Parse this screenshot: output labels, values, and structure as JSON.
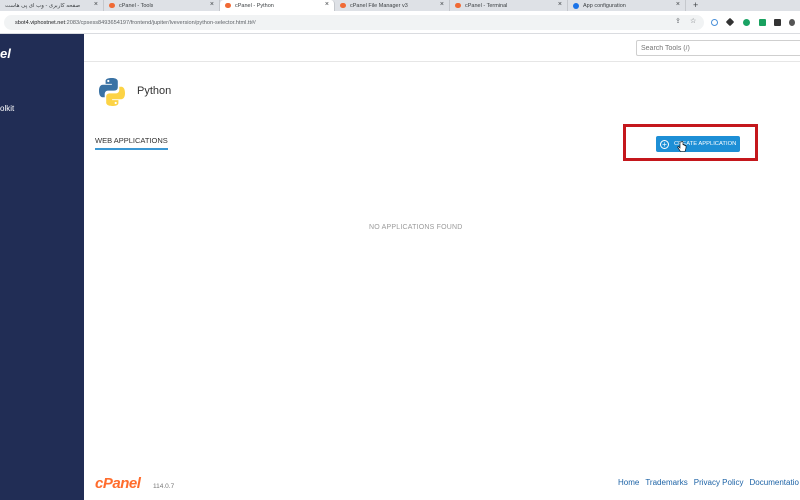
{
  "browser": {
    "tabs": [
      {
        "title": "صفحه کاربری - وب آی پی هاست",
        "active": false
      },
      {
        "title": "cPanel - Tools",
        "active": false
      },
      {
        "title": "cPanel - Python",
        "active": true
      },
      {
        "title": "cPanel File Manager v3",
        "active": false
      },
      {
        "title": "cPanel - Terminal",
        "active": false
      },
      {
        "title": "App configuration",
        "active": false
      }
    ],
    "new_tab_symbol": "+",
    "close_symbol": "×",
    "url_host": "sbot4.viphostnet.net",
    "url_path": ":2083/cpsess8493654197/frontend/jupiter/lveversion/python-selector.html.tt#/"
  },
  "sidebar": {
    "logo_fragment": "el",
    "item_fragment": "olkit"
  },
  "search": {
    "placeholder": "Search Tools (/)"
  },
  "page": {
    "title": "Python",
    "section_tab": "WEB APPLICATIONS",
    "create_button": "CREATE APPLICATION",
    "empty_message": "NO APPLICATIONS FOUND"
  },
  "footer": {
    "logo": "cPanel",
    "version": "114.0.7",
    "links": [
      "Home",
      "Trademarks",
      "Privacy Policy",
      "Documentatio"
    ]
  },
  "colors": {
    "sidebar_bg": "#212d55",
    "accent": "#1d8fd6",
    "highlight": "#c4171c",
    "brand": "#ff6c2c"
  }
}
